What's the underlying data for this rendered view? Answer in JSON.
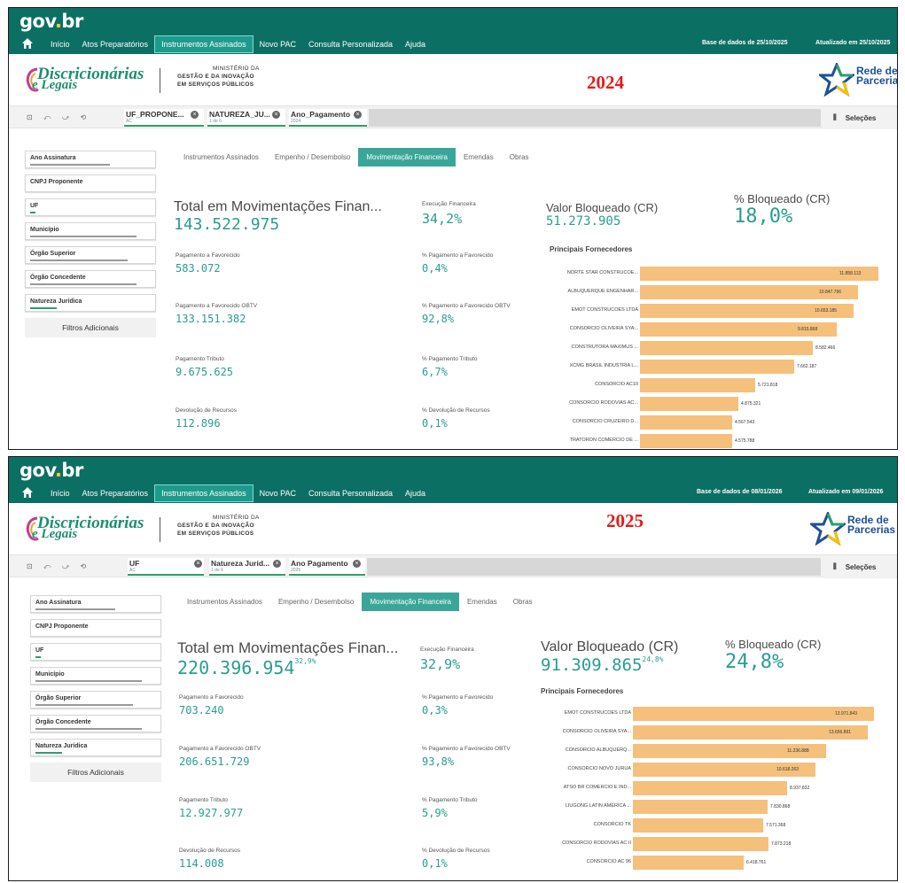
{
  "app": {
    "gov_logo_a": "gov",
    "gov_logo_dot": ".",
    "gov_logo_b": "br"
  },
  "nav": {
    "items": [
      "Início",
      "Atos Preparatórios",
      "Instrumentos Assinados",
      "Novo PAC",
      "Consulta Personalizada",
      "Ajuda"
    ],
    "active_index": 2
  },
  "brand": {
    "logo_line1": "Discricionárias",
    "logo_line2": "e Legais",
    "ministry_line1": "MINISTÉRIO DA",
    "ministry_line2": "GESTÃO E DA INOVAÇÃO",
    "ministry_line3": "EM SERVIÇOS PÚBLICOS",
    "rede_line1": "Rede de",
    "rede_line2": "Parcerias"
  },
  "tabs": [
    "Instrumentos Assinados",
    "Empenho / Desembolso",
    "Movimentação Financeira",
    "Emendas",
    "Obras"
  ],
  "filters": [
    "Ano Assinatura",
    "CNPJ Proponente",
    "UF",
    "Município",
    "Órgão Superior",
    "Órgão Concedente",
    "Natureza Jurídica"
  ],
  "filters_more": "Filtros Adicionais",
  "selecoes_label": "Seleções",
  "labels": {
    "total": "Total em Movimentações Finan...",
    "exec": "Execução Financeira",
    "pag_fav": "Pagamento a Favorecido",
    "pct_pag_fav": "% Pagamento a Favorecido",
    "pag_obtv": "Pagamento a Favorecido OBTV",
    "pct_pag_obtv": "% Pagamento a Favorecido OBTV",
    "pag_trib": "Pagamento Tributo",
    "pct_pag_trib": "% Pagamento Tributo",
    "devol": "Devolução de Recursos",
    "pct_devol": "% Devolução de Recursos",
    "bloq": "Valor Bloqueado (CR)",
    "pct_bloq": "% Bloqueado (CR)",
    "fornecedores": "Principais Fornecedores"
  },
  "colors": {
    "brand_green": "#0c6f64",
    "accent_teal": "#2a9d8f",
    "bar_orange": "#f5c07c",
    "year_red": "#e31b1b"
  },
  "panels": [
    {
      "year": "2024",
      "base_dados": "Base de dados de 25/10/2025",
      "atualizado": "Atualizado em 25/10/2025",
      "chips": [
        {
          "label": "UF_PROPONE...",
          "sub": "AC"
        },
        {
          "label": "NATUREZA_JU...",
          "sub": "1 de 6"
        },
        {
          "label": "Ano_Pagamento",
          "sub": "2024"
        }
      ],
      "total": "143.522.975",
      "total_sup": "",
      "exec": "34,2%",
      "pag_fav": "583.072",
      "pct_pag_fav": "0,4%",
      "pag_obtv": "133.151.382",
      "pct_pag_obtv": "92,8%",
      "pag_trib": "9.675.625",
      "pct_pag_trib": "6,7%",
      "devol": "112.896",
      "pct_devol": "0,1%",
      "bloq": "51.273.905",
      "bloq_sup": "",
      "pct_bloq": "18,0%",
      "suppliers": [
        {
          "name": "NORTE STAR CONSTRUCOE...",
          "value": 11858113,
          "label": "11.858.113"
        },
        {
          "name": "ALBUQUERQUE ENGENHAR...",
          "value": 10847796,
          "label": "10.847.796"
        },
        {
          "name": "EMOT CONSTRUCOES LTDA",
          "value": 10653185,
          "label": "10.653.185"
        },
        {
          "name": "CONSORCIO OLIVEIRA SYA...",
          "value": 9815868,
          "label": "9.815.868"
        },
        {
          "name": "CONSTRUTORA MAXIMUS ...",
          "value": 8582466,
          "label": "8.582.466"
        },
        {
          "name": "XCMG BRASIL INDUSTRIA L...",
          "value": 7662187,
          "label": "7.662.187"
        },
        {
          "name": "CONSORCIO AC10",
          "value": 5721818,
          "label": "5.721.818"
        },
        {
          "name": "CONSORCIO RODOVIAS AC...",
          "value": 4875321,
          "label": "4.875.321"
        },
        {
          "name": "CONSORCIO CRUZEIRO D...",
          "value": 4567543,
          "label": "4.567.543"
        },
        {
          "name": "TRATORON COMERCIO DE ...",
          "value": 4575788,
          "label": "4.575.788"
        }
      ],
      "supplier_max": 12000000
    },
    {
      "year": "2025",
      "base_dados": "Base de dados de 08/01/2026",
      "atualizado": "Atualizado em 09/01/2026",
      "chips": [
        {
          "label": "UF",
          "sub": "AC"
        },
        {
          "label": "Natureza Jurid...",
          "sub": "1 de 6"
        },
        {
          "label": "Ano Pagamento",
          "sub": "2025"
        }
      ],
      "total": "220.396.954",
      "total_sup": "32,9%",
      "exec": "32,9%",
      "pag_fav": "703.240",
      "pct_pag_fav": "0,3%",
      "pag_obtv": "206.651.729",
      "pct_pag_obtv": "93,8%",
      "pag_trib": "12.927.977",
      "pct_pag_trib": "5,9%",
      "devol": "114.008",
      "pct_devol": "0,1%",
      "bloq": "91.309.865",
      "bloq_sup": "24,8%",
      "pct_bloq": "24,8%",
      "suppliers": [
        {
          "name": "EMOT CONSTRUCOES LTDA",
          "value": 13971843,
          "label": "13.971.843"
        },
        {
          "name": "CONSORCIO OLIVEIRA SYA...",
          "value": 13656891,
          "label": "13.656.891"
        },
        {
          "name": "CONSORCIO ALBUQUERQ...",
          "value": 11236888,
          "label": "11.236.888"
        },
        {
          "name": "CONSORCIO NOVO JURUA",
          "value": 10618263,
          "label": "10.618.263"
        },
        {
          "name": "ATSO BR COMERCIO E IND...",
          "value": 8937832,
          "label": "8.937.832"
        },
        {
          "name": "LIUGONG LATIN AMERICA ...",
          "value": 7830868,
          "label": "7.830.868"
        },
        {
          "name": "CONSORCIO TK",
          "value": 7571368,
          "label": "7.571.368"
        },
        {
          "name": "CONSORCIO RODOVIAS AC II",
          "value": 7873218,
          "label": "7.873.218"
        },
        {
          "name": "CONSORCIO AC 96",
          "value": 6418761,
          "label": "6.418.761"
        }
      ],
      "supplier_max": 14300000
    }
  ]
}
